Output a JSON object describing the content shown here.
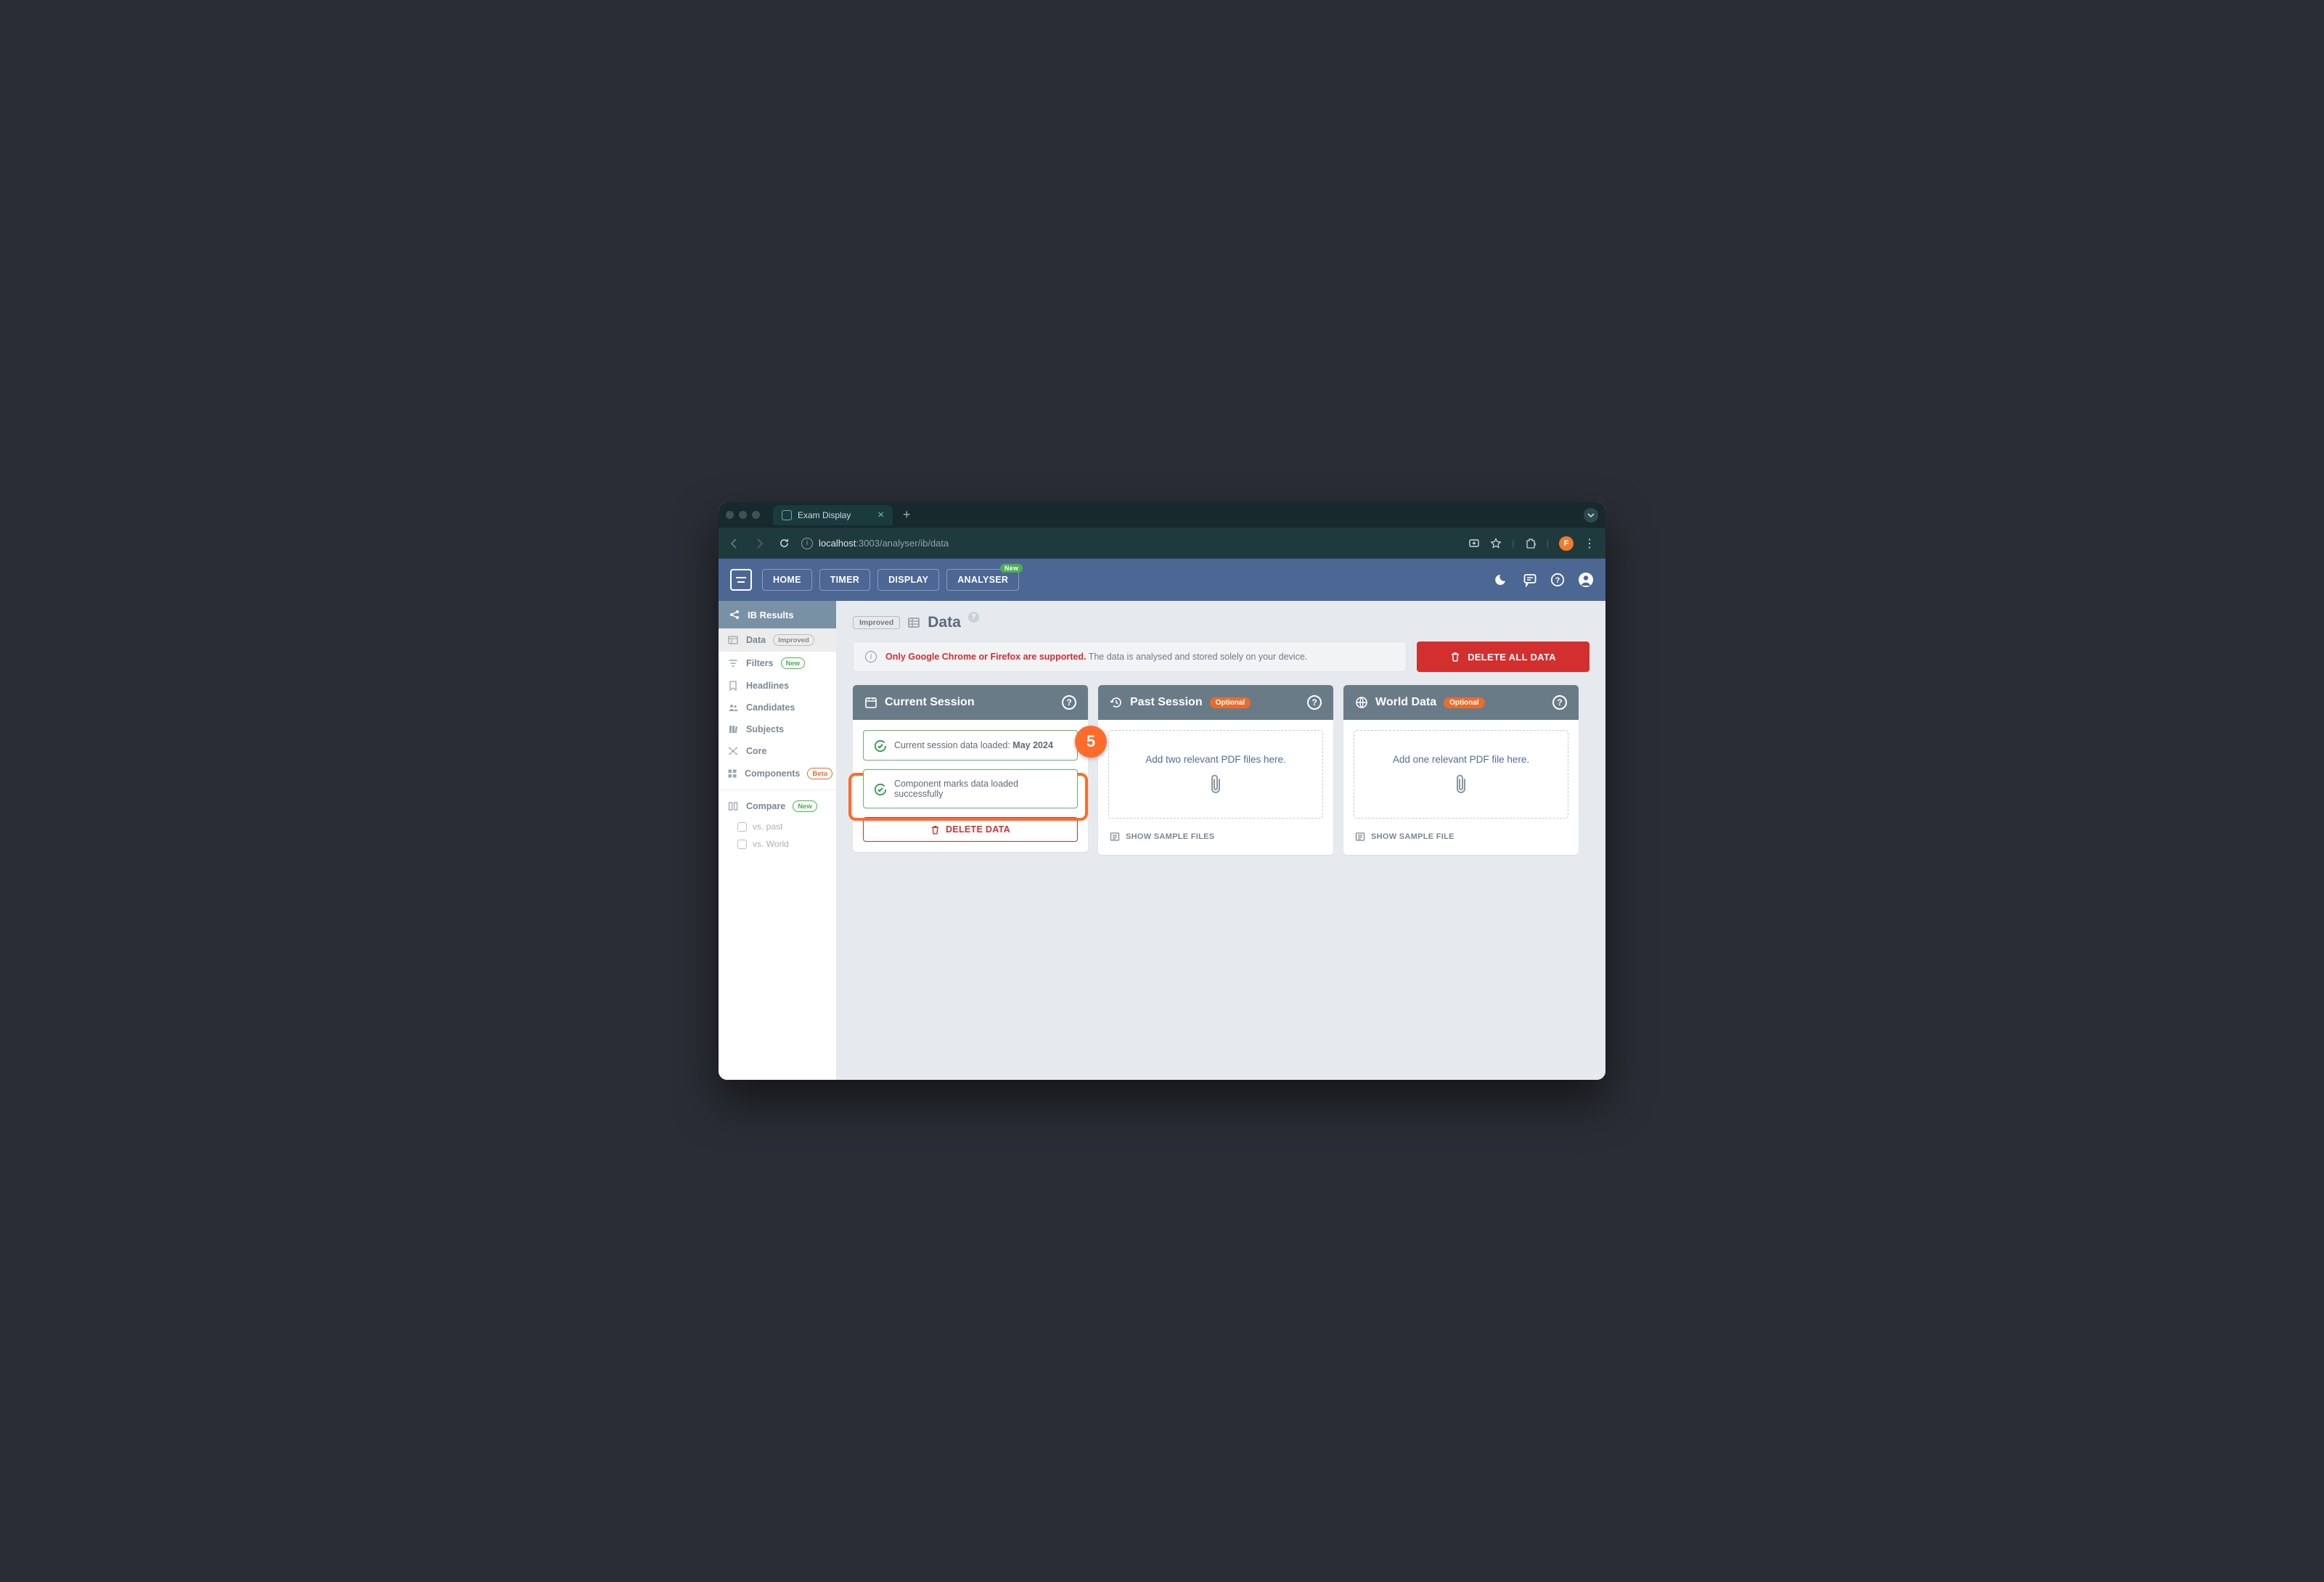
{
  "browser": {
    "tab_title": "Exam Display",
    "url_host": "localhost",
    "url_port_path": ":3003/analyser/ib/data",
    "avatar_letter": "F"
  },
  "header": {
    "nav": [
      "HOME",
      "TIMER",
      "DISPLAY",
      "ANALYSER"
    ],
    "new_badge": "New"
  },
  "sidebar": {
    "title": "IB Results",
    "items": [
      {
        "label": "Data",
        "badge": "Improved",
        "badge_style": "grey",
        "active": true
      },
      {
        "label": "Filters",
        "badge": "New",
        "badge_style": "green",
        "active": false
      },
      {
        "label": "Headlines",
        "badge": "",
        "badge_style": "",
        "active": false
      },
      {
        "label": "Candidates",
        "badge": "",
        "badge_style": "",
        "active": false
      },
      {
        "label": "Subjects",
        "badge": "",
        "badge_style": "",
        "active": false
      },
      {
        "label": "Core",
        "badge": "",
        "badge_style": "",
        "active": false
      },
      {
        "label": "Components",
        "badge": "Beta",
        "badge_style": "orange",
        "active": false
      }
    ],
    "compare": {
      "label": "Compare",
      "badge": "New",
      "subs": [
        "vs. past",
        "vs. World"
      ]
    }
  },
  "page": {
    "badge": "Improved",
    "title": "Data",
    "alert_warn": "Only Google Chrome or Firefox are supported.",
    "alert_rest": " The data is analysed and stored solely on your device.",
    "delete_all": "DELETE ALL DATA"
  },
  "cards": {
    "current": {
      "title": "Current Session",
      "status1_prefix": "Current session data loaded: ",
      "status1_bold": "May 2024",
      "status2": "Component marks data loaded successfully",
      "delete": "DELETE DATA",
      "step": "5"
    },
    "past": {
      "title": "Past Session",
      "badge": "Optional",
      "drop": "Add two relevant PDF files here.",
      "sample": "SHOW SAMPLE FILES"
    },
    "world": {
      "title": "World Data",
      "badge": "Optional",
      "drop": "Add one relevant PDF file here.",
      "sample": "SHOW SAMPLE FILE"
    }
  }
}
